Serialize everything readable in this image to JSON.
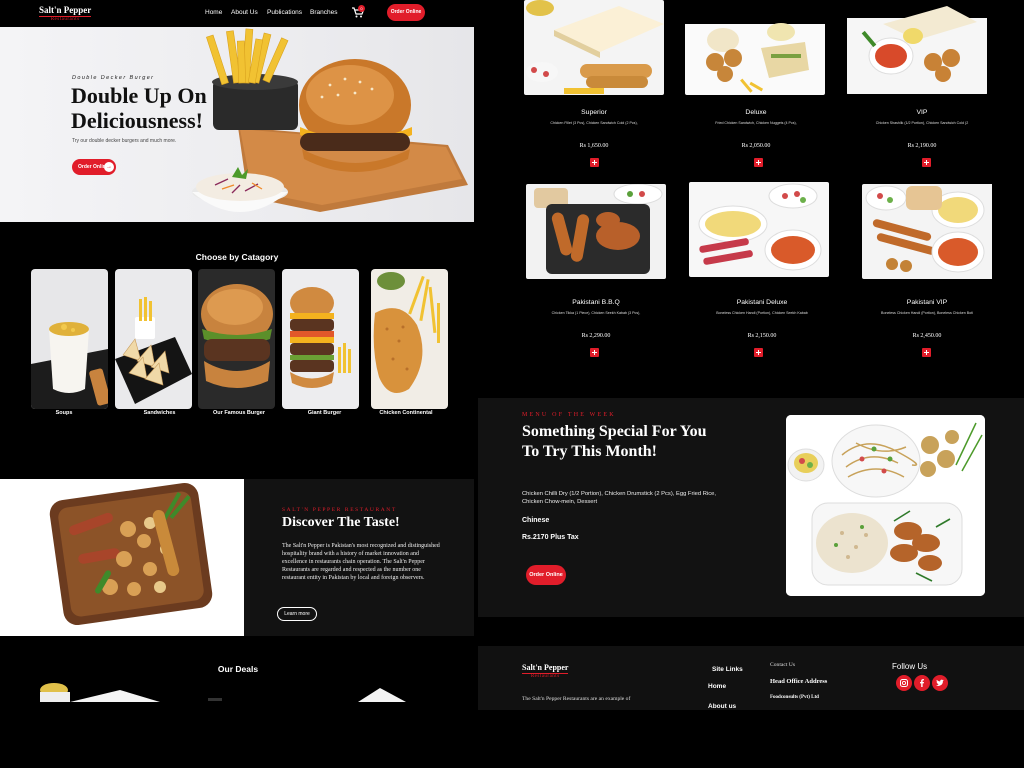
{
  "brand": {
    "name": "Salt'n Pepper",
    "tagline": "Restaurants"
  },
  "nav": {
    "links": [
      "Home",
      "About Us",
      "Publications",
      "Branches"
    ],
    "cart_count": "0",
    "order_btn": "Order Online"
  },
  "hero": {
    "tag": "Double Decker Burger",
    "title_line1": "Double Up On",
    "title_line2": "Deliciousness!",
    "subtitle": "Try our double decker burgers and much more.",
    "cta": "Order Online"
  },
  "categories": {
    "title": "Choose by Catagory",
    "items": [
      "Soups",
      "Sandwiches",
      "Our Famous Burger",
      "Giant Burger",
      "Chicken Continental"
    ]
  },
  "discover": {
    "tag": "SALT'N PEPPER RESTAURANT",
    "title": "Discover The Taste!",
    "body": "The Salt'n Pepper is Pakistan's most recognized and distinguished hospitality brand with a history of market innovation and excellence in restaurants chain operation. The Salt'n Pepper Restaurants are regarded and respected as the number one restaurant entity in Pakistan by local and foreign observers.",
    "cta": "Learn more"
  },
  "deals": {
    "title": "Our Deals"
  },
  "menu": {
    "items": [
      {
        "name": "Superior",
        "desc": "Chicken Fillet (3 Pcs), Chicken Sandwich Cold (2 Pcs),",
        "price": "Rs 1,650.00"
      },
      {
        "name": "Deluxe",
        "desc": "Fried Chicken Sandwich, Chicken Nuggets (4 Pcs),",
        "price": "Rs 2,050.00"
      },
      {
        "name": "VIP",
        "desc": "Chicken Shashlik (1/2 Portion), Chicken Sandwich Cold (2",
        "price": "Rs 2,190.00"
      },
      {
        "name": "Pakistani B.B.Q",
        "desc": "Chicken Tikka (1 Piece), Chicken Seekh Kabab (3 Pcs),",
        "price": "Rs 2,290.00"
      },
      {
        "name": "Pakistani Deluxe",
        "desc": "Boneless Chicken Handi (Portion), Chicken Seekh Kabab",
        "price": "Rs 2,150.00"
      },
      {
        "name": "Pakistani VIP",
        "desc": "Boneless Chicken Handi (Portion), Boneless Chicken Boti",
        "price": "Rs 2,450.00"
      }
    ]
  },
  "motw": {
    "tag": "MENU OF THE WEEK",
    "title": "Something Special For You To Try This Month!",
    "desc": "Chicken Chilli Dry (1/2 Portion), Chicken Drumstick (2 Pcs), Egg Fried Rice, Chicken Chow-mein, Dessert",
    "category": "Chinese",
    "price": "Rs.2170 Plus Tax",
    "cta": "Order Online"
  },
  "footer": {
    "about": "The Salt'n Pepper Restaurants are an example of",
    "site_links_title": "Site Links",
    "links": [
      "Home",
      "About us"
    ],
    "contact_title": "Contact Us",
    "office_title": "Head Office Address",
    "office_line": "Foodconsults (Pvt) Ltd",
    "follow_title": "Follow Us",
    "social": [
      "instagram-icon",
      "facebook-icon",
      "twitter-icon"
    ]
  },
  "colors": {
    "accent": "#e11d2a",
    "dark": "#121212",
    "bg": "#000000"
  }
}
